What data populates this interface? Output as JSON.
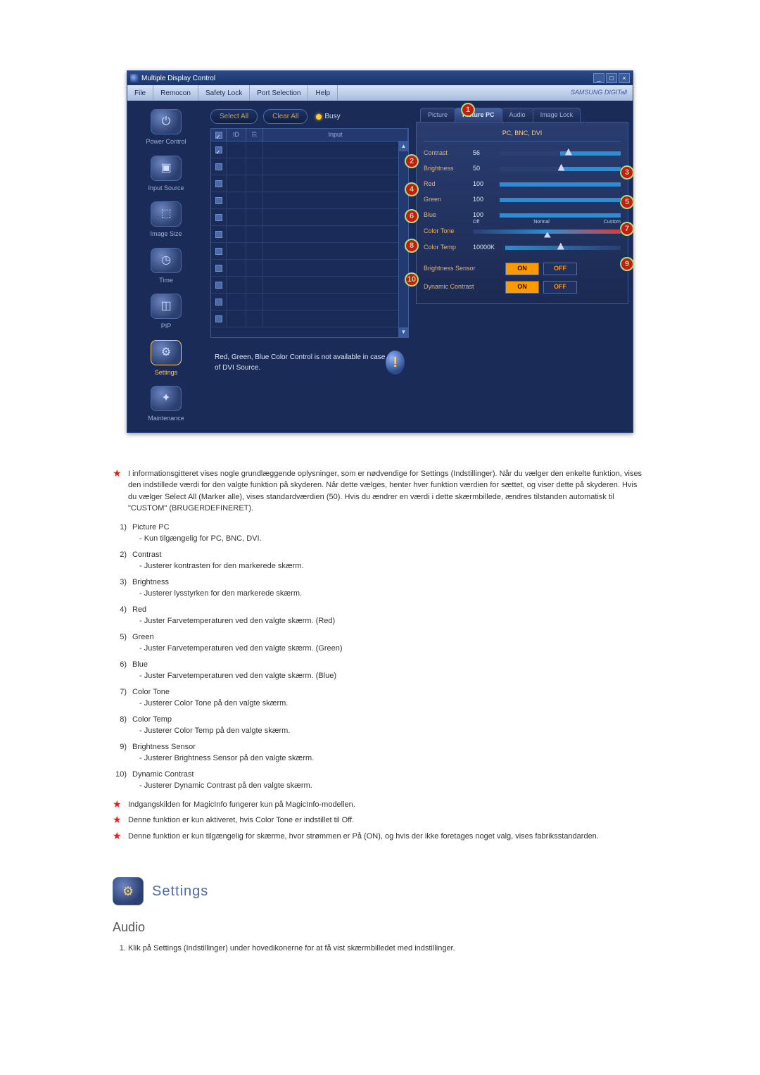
{
  "app": {
    "title": "Multiple Display Control",
    "menus": [
      "File",
      "Remocon",
      "Safety Lock",
      "Port Selection",
      "Help"
    ],
    "brand": "SAMSUNG DIGITall"
  },
  "sidebar": {
    "items": [
      {
        "label": "Power Control",
        "glyph": "⏻"
      },
      {
        "label": "Input Source",
        "glyph": "▣"
      },
      {
        "label": "Image Size",
        "glyph": "⬚"
      },
      {
        "label": "Time",
        "glyph": "◷"
      },
      {
        "label": "PIP",
        "glyph": "◫"
      },
      {
        "label": "Settings",
        "glyph": "⚙"
      },
      {
        "label": "Maintenance",
        "glyph": "✦"
      }
    ],
    "active_index": 5
  },
  "center": {
    "select_all": "Select All",
    "clear_all": "Clear All",
    "busy": "Busy",
    "grid_headers": {
      "chk": "☑",
      "id": "ID",
      "ctrl": "⎘",
      "input": "Input"
    },
    "rows_checked": [
      true,
      false,
      false,
      false,
      false,
      false,
      false,
      false,
      false,
      false,
      false
    ],
    "footer_note": "Red, Green, Blue Color Control is not available in case of DVI Source.",
    "footer_icon": "!"
  },
  "right": {
    "tabs": [
      "Picture",
      "Picture PC",
      "Audio",
      "Image Lock"
    ],
    "active_tab": 1,
    "source_line": "PC, BNC, DVI",
    "contrast": {
      "label": "Contrast",
      "value": "56"
    },
    "brightness": {
      "label": "Brightness",
      "value": "50"
    },
    "red": {
      "label": "Red",
      "value": "100"
    },
    "green": {
      "label": "Green",
      "value": "100"
    },
    "blue": {
      "label": "Blue",
      "value": "100"
    },
    "color_tone": {
      "label": "Color Tone",
      "opts": [
        "Off",
        "Normal",
        "Custom"
      ]
    },
    "color_temp": {
      "label": "Color Temp",
      "value": "10000K"
    },
    "brightness_sensor": {
      "label": "Brightness Sensor",
      "on": "ON",
      "off": "OFF"
    },
    "dynamic_contrast": {
      "label": "Dynamic Contrast",
      "on": "ON",
      "off": "OFF"
    }
  },
  "badges": {
    "1": "1",
    "2": "2",
    "3": "3",
    "4": "4",
    "5": "5",
    "6": "6",
    "7": "7",
    "8": "8",
    "9": "9",
    "10": "10"
  },
  "doc": {
    "intro": "I informationsgitteret vises nogle grundlæggende oplysninger, som er nødvendige for Settings (Indstillinger). Når du vælger den enkelte funktion, vises den indstillede værdi for den valgte funktion på skyderen. Når dette vælges, henter hver funktion værdien for sættet, og viser dette på skyderen. Hvis du vælger Select All (Marker alle), vises standardværdien (50). Hvis du ændrer en værdi i dette skærmbillede, ændres tilstanden automatisk til \"CUSTOM\" (BRUGERDEFINERET).",
    "items": [
      {
        "n": "1)",
        "title": "Picture PC",
        "sub": "- Kun tilgængelig for PC, BNC, DVI."
      },
      {
        "n": "2)",
        "title": "Contrast",
        "sub": "- Justerer kontrasten for den markerede skærm."
      },
      {
        "n": "3)",
        "title": "Brightness",
        "sub": "- Justerer lysstyrken for den markerede skærm."
      },
      {
        "n": "4)",
        "title": "Red",
        "sub": "- Juster Farvetemperaturen ved den valgte skærm. (Red)"
      },
      {
        "n": "5)",
        "title": "Green",
        "sub": "- Juster Farvetemperaturen ved den valgte skærm. (Green)"
      },
      {
        "n": "6)",
        "title": "Blue",
        "sub": "- Juster Farvetemperaturen ved den valgte skærm. (Blue)"
      },
      {
        "n": "7)",
        "title": "Color Tone",
        "sub": "- Justerer Color Tone på den valgte skærm."
      },
      {
        "n": "8)",
        "title": "Color Temp",
        "sub": "- Justerer Color Temp på den valgte skærm."
      },
      {
        "n": "9)",
        "title": "Brightness Sensor",
        "sub": "- Justerer Brightness Sensor på den valgte skærm."
      },
      {
        "n": "10)",
        "title": "Dynamic Contrast",
        "sub": "- Justerer Dynamic Contrast på den valgte skærm."
      }
    ],
    "notes": [
      "Indgangskilden for MagicInfo fungerer kun på MagicInfo-modellen.",
      "Denne funktion er kun aktiveret, hvis Color Tone er indstillet til Off.",
      "Denne funktion er kun tilgængelig for skærme, hvor strømmen er På (ON), og hvis der ikke foretages noget valg, vises fabriksstandarden."
    ],
    "section_title": "Settings",
    "audio_title": "Audio",
    "audio_step1": "Klik på Settings (Indstillinger) under hovedikonerne for at få vist skærmbilledet med indstillinger."
  }
}
